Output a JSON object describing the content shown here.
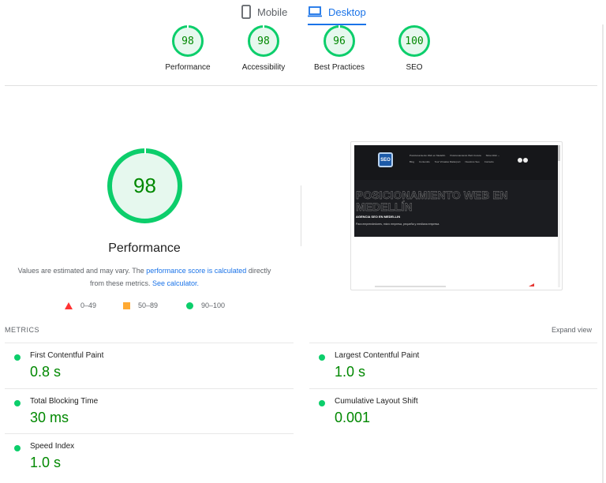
{
  "tabs": [
    {
      "label": "Mobile",
      "icon": "phone-icon",
      "active": false
    },
    {
      "label": "Desktop",
      "icon": "laptop-icon",
      "active": true
    }
  ],
  "summary_gauges": [
    {
      "score": "98",
      "label": "Performance"
    },
    {
      "score": "98",
      "label": "Accessibility"
    },
    {
      "score": "96",
      "label": "Best Practices"
    },
    {
      "score": "100",
      "label": "SEO"
    }
  ],
  "performance": {
    "score": "98",
    "title": "Performance",
    "desc_prefix": "Values are estimated and may vary. The ",
    "desc_link1": "performance score is calculated",
    "desc_middle": " directly from these metrics. ",
    "desc_link2": "See calculator."
  },
  "legend": [
    {
      "shape": "triangle",
      "range": "0–49",
      "color": "#ff3333"
    },
    {
      "shape": "square",
      "range": "50–89",
      "color": "#ffaa33"
    },
    {
      "shape": "circle",
      "range": "90–100",
      "color": "#0cce6b"
    }
  ],
  "screenshot": {
    "logo_text": "SEO",
    "nav_row1": [
      "Posicionamiento Web en Medellín",
      "Posicionamiento Web Cucuta",
      "Sitios Web ⌄"
    ],
    "nav_row2": [
      "Blog",
      "Contenido",
      "Tour Virtuales Matterport",
      "Nuestros Seo",
      "Contacto"
    ],
    "hero_title": "POSICIONAMIENTO WEB EN MEDELLÍN",
    "subtitle": "AGENCIA SEO EN MEDELLIN",
    "tagline": "Para emprendedores, micro empresa, pequeña y mediana empresa."
  },
  "metrics": {
    "header": "METRICS",
    "expand_label": "Expand view",
    "items": [
      {
        "label": "First Contentful Paint",
        "value": "0.8 s",
        "status": "good"
      },
      {
        "label": "Largest Contentful Paint",
        "value": "1.0 s",
        "status": "good"
      },
      {
        "label": "Total Blocking Time",
        "value": "30 ms",
        "status": "good"
      },
      {
        "label": "Cumulative Layout Shift",
        "value": "0.001",
        "status": "good"
      },
      {
        "label": "Speed Index",
        "value": "1.0 s",
        "status": "good"
      }
    ]
  },
  "colors": {
    "pass": "#0cce6b",
    "pass_text": "#008800",
    "average": "#ffaa33",
    "fail": "#ff3333",
    "accent": "#1a73e8"
  }
}
